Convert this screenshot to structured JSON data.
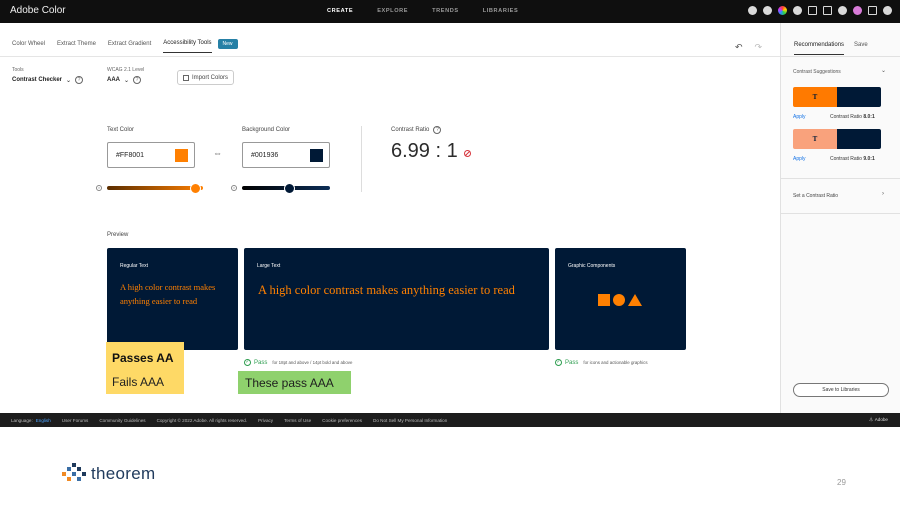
{
  "topbar": {
    "title": "Adobe Color",
    "nav": [
      "CREATE",
      "EXPLORE",
      "TRENDS",
      "LIBRARIES"
    ],
    "active_nav": "CREATE"
  },
  "tabs": {
    "items": [
      "Color Wheel",
      "Extract Theme",
      "Extract Gradient",
      "Accessibility Tools"
    ],
    "active": "Accessibility Tools",
    "badge": "New"
  },
  "tools": {
    "tools_label": "Tools",
    "tool_value": "Contrast Checker",
    "wcag_label": "WCAG 2.1 Level",
    "wcag_value": "AAA",
    "import_label": "Import Colors"
  },
  "text_color": {
    "label": "Text Color",
    "hex": "#FF8001",
    "swatch": "#FF8001",
    "slider_level": 0.92
  },
  "background_color": {
    "label": "Background Color",
    "hex": "#001936",
    "swatch": "#001936",
    "slider_level": 0.53
  },
  "contrast": {
    "label": "Contrast Ratio",
    "value": "6.99 : 1"
  },
  "preview": {
    "label": "Preview",
    "cards": [
      {
        "title": "Regular Text",
        "body": "A high color contrast makes anything easier to read"
      },
      {
        "title": "Large Text",
        "body": "A high color contrast makes anything easier to read"
      },
      {
        "title": "Graphic Components"
      }
    ],
    "pass_word": "Pass",
    "large_pass_note": "for 18pt and above / 14pt bold and above",
    "graphic_pass_note": "for icons and actionable graphics"
  },
  "annotations": {
    "passes_aa": "Passes AA",
    "fails_aaa": "Fails AAA",
    "these_pass_aaa": "These pass AAA"
  },
  "right_panel": {
    "tabs": [
      "Recommendations",
      "Save"
    ],
    "suggestions_label": "Contrast Suggestions",
    "suggestions": [
      {
        "sample": "T",
        "color": "#FF7A00",
        "apply": "Apply",
        "ratio_label": "Contrast Ratio",
        "ratio": "8.0:1"
      },
      {
        "sample": "T",
        "color": "#F9A27C",
        "apply": "Apply",
        "ratio_label": "Contrast Ratio",
        "ratio": "9.0:1"
      }
    ],
    "set_ratio": "Set a Contrast Ratio",
    "save_button": "Save to Libraries"
  },
  "footer": {
    "language_label": "Language:",
    "language_value": "English",
    "links": [
      "User Forums",
      "Community Guidelines",
      "Copyright © 2022 Adobe. All rights reserved.",
      "Privacy",
      "Terms of Use",
      "Cookie preferences",
      "Do Not Sell My Personal Information"
    ],
    "brand": "Adobe"
  },
  "slide": {
    "brand": "theorem",
    "page_number": "29"
  },
  "colors": {
    "text": "#FF8001",
    "background": "#001936",
    "pass_green": "#2D9D4F",
    "note_yellow": "#FED966",
    "note_green": "#8FD16D"
  }
}
